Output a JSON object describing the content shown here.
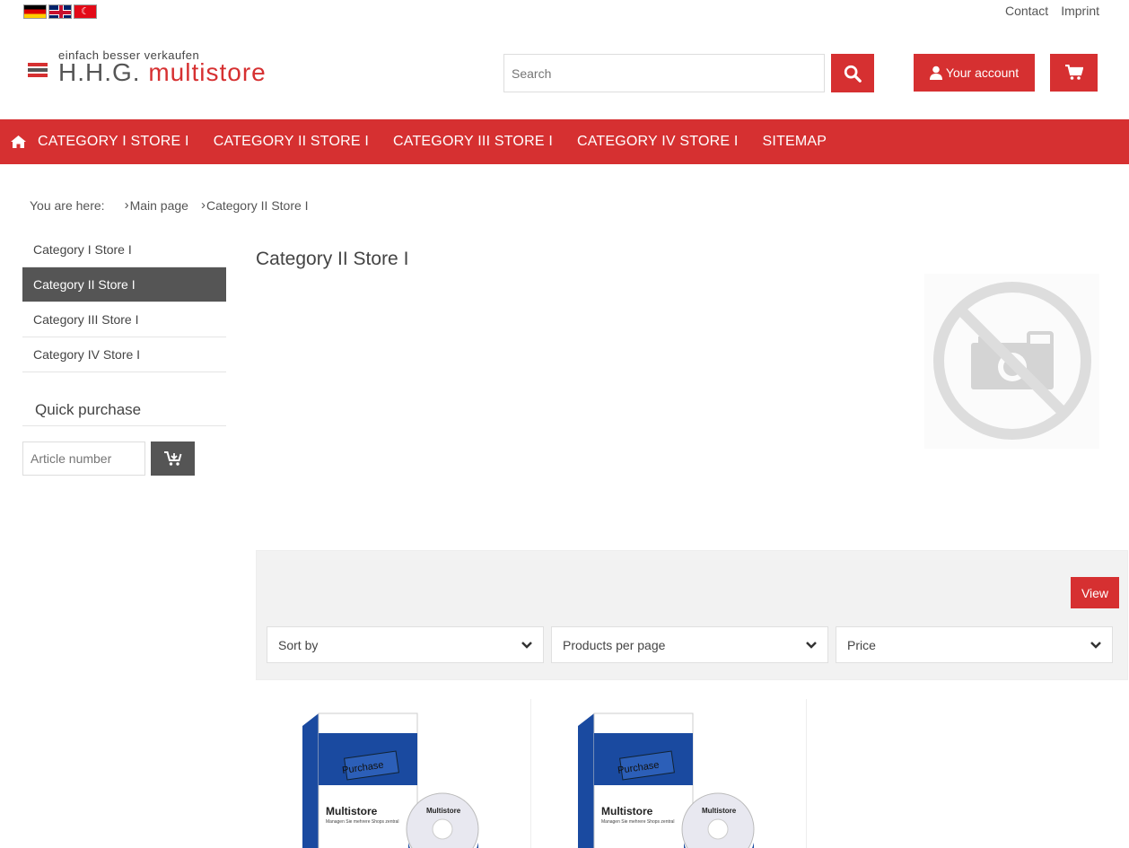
{
  "languages": [
    {
      "name": "German"
    },
    {
      "name": "English"
    },
    {
      "name": "Turkish"
    }
  ],
  "toplinks": {
    "contact": "Contact",
    "imprint": "Imprint"
  },
  "logo": {
    "tagline": "einfach besser verkaufen",
    "brand_part1": "H.H.G.",
    "brand_part2": "multistore"
  },
  "search": {
    "placeholder": "Search"
  },
  "account": {
    "label": "Your account"
  },
  "nav": {
    "items": [
      "CATEGORY I STORE I",
      "CATEGORY II STORE I",
      "CATEGORY III STORE I",
      "CATEGORY IV STORE I",
      "SITEMAP"
    ]
  },
  "breadcrumb": {
    "prefix": "You are here:",
    "items": [
      "Main page",
      "Category II Store I"
    ]
  },
  "sidebar": {
    "items": [
      "Category I Store I",
      "Category II Store I",
      "Category III Store I",
      "Category IV Store I"
    ],
    "active_index": 1
  },
  "quick_purchase": {
    "title": "Quick purchase",
    "placeholder": "Article number"
  },
  "main": {
    "title": "Category II Store I"
  },
  "filters": {
    "view_label": "View",
    "sort_by": "Sort by",
    "per_page": "Products per page",
    "price": "Price"
  },
  "products": [
    {
      "box_title": "Multistore",
      "box_sub": "Managen Sie mehrere Shops zentral",
      "sticker": "Purchase",
      "disc": "Multistore"
    },
    {
      "box_title": "Multistore",
      "box_sub": "Managen Sie mehrere Shops zentral",
      "sticker": "Purchase",
      "disc": "Multistore"
    }
  ],
  "colors": {
    "accent": "#d63031",
    "dark": "#555555"
  }
}
